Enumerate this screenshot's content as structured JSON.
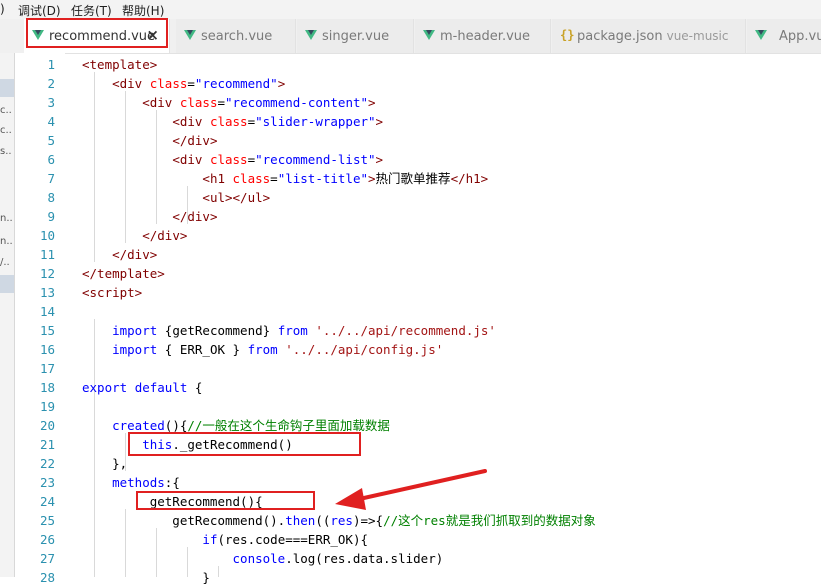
{
  "menu": {
    "fragment": ")",
    "items": [
      "调试(D)",
      "任务(T)",
      "帮助(H)"
    ]
  },
  "tabs": [
    {
      "label": "recommend.vue",
      "icon": "vue-icon",
      "active": true,
      "close": "×"
    },
    {
      "label": "search.vue",
      "icon": "vue-icon"
    },
    {
      "label": "singer.vue",
      "icon": "vue-icon"
    },
    {
      "label": "m-header.vue",
      "icon": "vue-icon"
    },
    {
      "label": "package.json",
      "sub": "vue-music",
      "icon": "json-braces-icon"
    },
    {
      "label": "App.vue",
      "icon": "vue-icon"
    }
  ],
  "side_fragments": [
    "c..",
    "c..",
    "s..",
    "n..",
    "n..",
    "/.."
  ],
  "line_numbers": [
    "1",
    "2",
    "3",
    "4",
    "5",
    "6",
    "7",
    "8",
    "9",
    "10",
    "11",
    "12",
    "13",
    "14",
    "15",
    "16",
    "17",
    "18",
    "19",
    "20",
    "21",
    "22",
    "23",
    "24",
    "25",
    "26",
    "27",
    "28"
  ],
  "code_lines": [
    [
      [
        "tg",
        "<template>"
      ]
    ],
    [
      [
        "df",
        "    "
      ],
      [
        "tg",
        "<div "
      ],
      [
        "at",
        "class"
      ],
      [
        "df",
        "="
      ],
      [
        "str",
        "\"recommend\""
      ],
      [
        "tg",
        ">"
      ]
    ],
    [
      [
        "df",
        "        "
      ],
      [
        "tg",
        "<div "
      ],
      [
        "at",
        "class"
      ],
      [
        "df",
        "="
      ],
      [
        "str",
        "\"recommend-content\""
      ],
      [
        "tg",
        ">"
      ]
    ],
    [
      [
        "df",
        "            "
      ],
      [
        "tg",
        "<div "
      ],
      [
        "at",
        "class"
      ],
      [
        "df",
        "="
      ],
      [
        "str",
        "\"slider-wrapper\""
      ],
      [
        "tg",
        ">"
      ]
    ],
    [
      [
        "df",
        "            "
      ],
      [
        "tg",
        "</div>"
      ]
    ],
    [
      [
        "df",
        "            "
      ],
      [
        "tg",
        "<div "
      ],
      [
        "at",
        "class"
      ],
      [
        "df",
        "="
      ],
      [
        "str",
        "\"recommend-list\""
      ],
      [
        "tg",
        ">"
      ]
    ],
    [
      [
        "df",
        "                "
      ],
      [
        "tg",
        "<h1 "
      ],
      [
        "at",
        "class"
      ],
      [
        "df",
        "="
      ],
      [
        "str",
        "\"list-title\""
      ],
      [
        "tg",
        ">"
      ],
      [
        "df",
        "热门歌单推荐"
      ],
      [
        "tg",
        "</h1>"
      ]
    ],
    [
      [
        "df",
        "                "
      ],
      [
        "tg",
        "<ul></ul>"
      ]
    ],
    [
      [
        "df",
        "            "
      ],
      [
        "tg",
        "</div>"
      ]
    ],
    [
      [
        "df",
        "        "
      ],
      [
        "tg",
        "</div>"
      ]
    ],
    [
      [
        "df",
        "    "
      ],
      [
        "tg",
        "</div>"
      ]
    ],
    [
      [
        "tg",
        "</template>"
      ]
    ],
    [
      [
        "tg",
        "<script>"
      ]
    ],
    [],
    [
      [
        "df",
        "    "
      ],
      [
        "kw",
        "import"
      ],
      [
        "df",
        " {getRecommend} "
      ],
      [
        "kw",
        "from"
      ],
      [
        "df",
        " "
      ],
      [
        "st",
        "'../../api/recommend.js'"
      ]
    ],
    [
      [
        "df",
        "    "
      ],
      [
        "kw",
        "import"
      ],
      [
        "df",
        " { ERR_OK } "
      ],
      [
        "kw",
        "from"
      ],
      [
        "df",
        " "
      ],
      [
        "st",
        "'../../api/config.js'"
      ]
    ],
    [],
    [
      [
        "kw",
        "export"
      ],
      [
        "df",
        " "
      ],
      [
        "kw",
        "default"
      ],
      [
        "df",
        " {"
      ]
    ],
    [],
    [
      [
        "df",
        "    "
      ],
      [
        "kw",
        "created"
      ],
      [
        "df",
        "(){"
      ],
      [
        "cm",
        "//一般在这个生命钩子里面加载数据"
      ]
    ],
    [
      [
        "df",
        "        "
      ],
      [
        "kw",
        "this"
      ],
      [
        "df",
        "._getRecommend()"
      ]
    ],
    [
      [
        "df",
        "    },"
      ]
    ],
    [
      [
        "df",
        "    "
      ],
      [
        "kw",
        "methods"
      ],
      [
        "df",
        ":{"
      ]
    ],
    [
      [
        "df",
        "        _getRecommend(){"
      ]
    ],
    [
      [
        "df",
        "            getRecommend()."
      ],
      [
        "kw",
        "then"
      ],
      [
        "df",
        "(("
      ],
      [
        "kw",
        "res"
      ],
      [
        "df",
        ")=>{"
      ],
      [
        "cm",
        "//这个res就是我们抓取到的数据对象"
      ]
    ],
    [
      [
        "df",
        "                "
      ],
      [
        "kw",
        "if"
      ],
      [
        "df",
        "(res.code===ERR_OK){"
      ]
    ],
    [
      [
        "df",
        "                    "
      ],
      [
        "kw",
        "console"
      ],
      [
        "df",
        ".log(res.data.slider)"
      ]
    ],
    [
      [
        "df",
        "                }"
      ]
    ]
  ],
  "colors": {
    "annotation_red": "#e02020",
    "line_number": "#2b91af",
    "tag": "#800000",
    "attribute": "#ff0000",
    "keyword": "#0000ff",
    "string": "#a31515",
    "comment": "#008000",
    "vue_icon": "#41b883"
  }
}
